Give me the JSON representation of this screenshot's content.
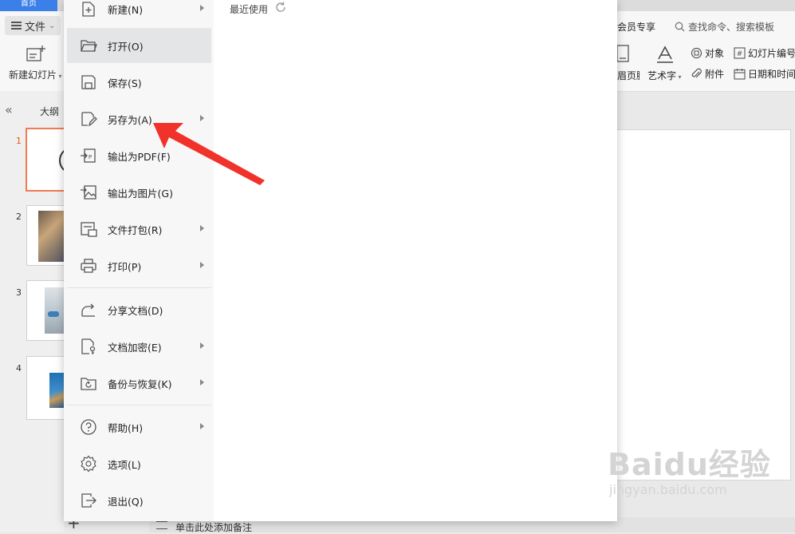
{
  "app": {
    "tab_label": "首页",
    "file_menu_label": "文件",
    "new_slide_label": "新建幻灯片",
    "ribbon": {
      "member_label": "会员专享",
      "search_placeholder": "查找命令、搜索模板",
      "object_label": "对象",
      "slide_number_label": "幻灯片编号",
      "header_footer_label": "页眉页脚",
      "art_text_label": "艺术字",
      "attachment_label": "附件",
      "date_time_label": "日期和时间"
    },
    "panel": {
      "outline_label": "大纲",
      "slides": [
        "1",
        "2",
        "3",
        "4"
      ]
    },
    "notes_placeholder": "单击此处添加备注"
  },
  "file_menu": {
    "recent_label": "最近使用",
    "items": [
      {
        "label": "新建(N)",
        "icon": "new-file-icon",
        "submenu": true
      },
      {
        "label": "打开(O)",
        "icon": "folder-open-icon",
        "submenu": false,
        "active": true
      },
      {
        "label": "保存(S)",
        "icon": "save-icon",
        "submenu": false
      },
      {
        "label": "另存为(A)",
        "icon": "save-as-icon",
        "submenu": true
      },
      {
        "label": "输出为PDF(F)",
        "icon": "export-pdf-icon",
        "submenu": false
      },
      {
        "label": "输出为图片(G)",
        "icon": "export-image-icon",
        "submenu": false
      },
      {
        "label": "文件打包(R)",
        "icon": "package-icon",
        "submenu": true
      },
      {
        "label": "打印(P)",
        "icon": "print-icon",
        "submenu": true
      },
      {
        "label": "分享文档(D)",
        "icon": "share-icon",
        "submenu": false
      },
      {
        "label": "文档加密(E)",
        "icon": "encrypt-icon",
        "submenu": true
      },
      {
        "label": "备份与恢复(K)",
        "icon": "backup-icon",
        "submenu": true
      },
      {
        "label": "帮助(H)",
        "icon": "help-icon",
        "submenu": true
      },
      {
        "label": "选项(L)",
        "icon": "gear-icon",
        "submenu": false
      },
      {
        "label": "退出(Q)",
        "icon": "exit-icon",
        "submenu": false
      }
    ]
  },
  "annotation": {
    "color": "#f0322a"
  },
  "watermark": {
    "brand": "Baidu经验",
    "url": "jingyan.baidu.com"
  }
}
